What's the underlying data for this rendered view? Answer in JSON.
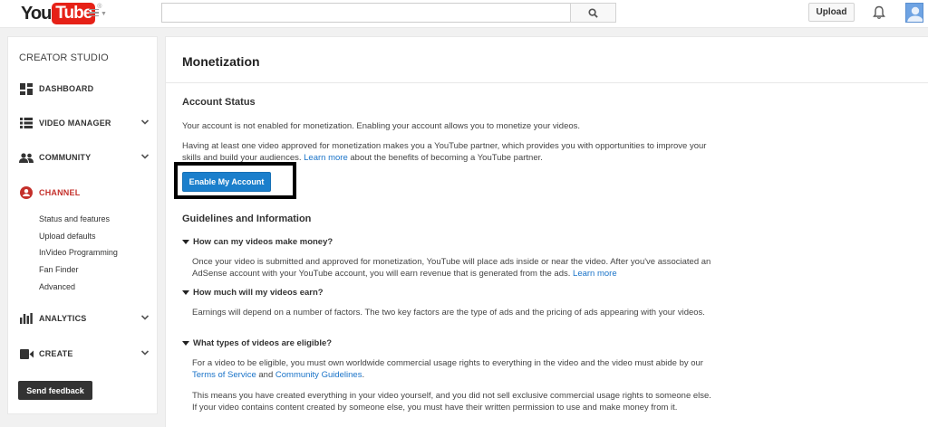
{
  "header": {
    "logo_you": "You",
    "logo_tube": "Tube",
    "logo_tm": "®",
    "search_placeholder": "",
    "upload_label": "Upload"
  },
  "sidebar": {
    "title": "CREATOR STUDIO",
    "items": [
      {
        "label": "DASHBOARD",
        "icon": "dashboard-icon"
      },
      {
        "label": "VIDEO MANAGER",
        "icon": "video-manager-icon"
      },
      {
        "label": "COMMUNITY",
        "icon": "community-icon"
      },
      {
        "label": "CHANNEL",
        "icon": "channel-icon"
      },
      {
        "label": "ANALYTICS",
        "icon": "analytics-icon"
      },
      {
        "label": "CREATE",
        "icon": "create-icon"
      }
    ],
    "channel_sub": [
      "Status and features",
      "Upload defaults",
      "InVideo Programming",
      "Fan Finder",
      "Advanced"
    ],
    "feedback_label": "Send feedback"
  },
  "main": {
    "title": "Monetization",
    "account_status": {
      "heading": "Account Status",
      "p1": "Your account is not enabled for monetization. Enabling your account allows you to monetize your videos.",
      "p2_a": "Having at least one video approved for monetization makes you a YouTube partner, which provides you with opportunities to improve your skills and build your audiences.",
      "p2_link": "Learn more",
      "p2_b": "about the benefits of becoming a YouTube partner.",
      "enable_label": "Enable My Account"
    },
    "guidelines": {
      "heading": "Guidelines and Information",
      "q1": "How can my videos make money?",
      "a1": "Once your video is submitted and approved for monetization, YouTube will place ads inside or near the video. After you've associated an AdSense account with your YouTube account, you will earn revenue that is generated from the ads.",
      "a1_link": "Learn more",
      "q2": "How much will my videos earn?",
      "a2": "Earnings will depend on a number of factors. The two key factors are the type of ads and the pricing of ads appearing with your videos.",
      "q3": "What types of videos are eligible?",
      "a3_a": "For a video to be eligible, you must own worldwide commercial usage rights to everything in the video and the video must abide by our",
      "a3_link1": "Terms of Service",
      "a3_and": "and",
      "a3_link2": "Community Guidelines",
      "a3_end": ".",
      "a3_p2": "This means you have created everything in your video yourself, and you did not sell exclusive commercial usage rights to someone else. If your video contains content created by someone else, you must have their written permission to use and make money from it."
    }
  },
  "colors": {
    "brand_red": "#e62117",
    "active_red": "#c4302b",
    "link_blue": "#1a73c8",
    "button_blue": "#1b7fcc"
  }
}
